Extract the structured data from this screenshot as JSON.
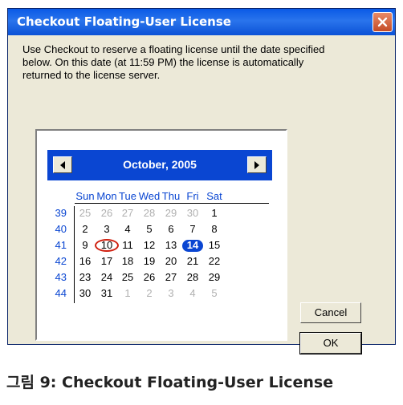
{
  "dialog": {
    "title": "Checkout Floating-User License",
    "description": "Use Checkout to reserve a floating license until the date specified below. On this date (at 11:59 PM) the license is automatically returned to the license server.",
    "close_icon": "close-x-icon",
    "buttons": {
      "cancel": "Cancel",
      "ok": "OK"
    }
  },
  "calendar": {
    "month_title": "October, 2005",
    "prev_icon": "left-triangle-icon",
    "next_icon": "right-triangle-icon",
    "days_of_week": [
      "Sun",
      "Mon",
      "Tue",
      "Wed",
      "Thu",
      "Fri",
      "Sat"
    ],
    "weeks": [
      {
        "week": "39",
        "days": [
          {
            "d": "25",
            "other": true
          },
          {
            "d": "26",
            "other": true
          },
          {
            "d": "27",
            "other": true
          },
          {
            "d": "28",
            "other": true
          },
          {
            "d": "29",
            "other": true
          },
          {
            "d": "30",
            "other": true
          },
          {
            "d": "1"
          }
        ]
      },
      {
        "week": "40",
        "days": [
          {
            "d": "2"
          },
          {
            "d": "3"
          },
          {
            "d": "4"
          },
          {
            "d": "5"
          },
          {
            "d": "6"
          },
          {
            "d": "7"
          },
          {
            "d": "8"
          }
        ]
      },
      {
        "week": "41",
        "days": [
          {
            "d": "9"
          },
          {
            "d": "10",
            "today": true
          },
          {
            "d": "11"
          },
          {
            "d": "12"
          },
          {
            "d": "13"
          },
          {
            "d": "14",
            "selected": true
          },
          {
            "d": "15"
          }
        ]
      },
      {
        "week": "42",
        "days": [
          {
            "d": "16"
          },
          {
            "d": "17"
          },
          {
            "d": "18"
          },
          {
            "d": "19"
          },
          {
            "d": "20"
          },
          {
            "d": "21"
          },
          {
            "d": "22"
          }
        ]
      },
      {
        "week": "43",
        "days": [
          {
            "d": "23"
          },
          {
            "d": "24"
          },
          {
            "d": "25"
          },
          {
            "d": "26"
          },
          {
            "d": "27"
          },
          {
            "d": "28"
          },
          {
            "d": "29"
          }
        ]
      },
      {
        "week": "44",
        "days": [
          {
            "d": "30"
          },
          {
            "d": "31"
          },
          {
            "d": "1",
            "other": true
          },
          {
            "d": "2",
            "other": true
          },
          {
            "d": "3",
            "other": true
          },
          {
            "d": "4",
            "other": true
          },
          {
            "d": "5",
            "other": true
          }
        ]
      }
    ],
    "colors": {
      "header_bg": "#0a46d2",
      "selected_bg": "#0a46d2",
      "today_ring": "#d02010",
      "other_month": "#b0b0b0"
    }
  },
  "caption": "그림 9: Checkout Floating-User License"
}
